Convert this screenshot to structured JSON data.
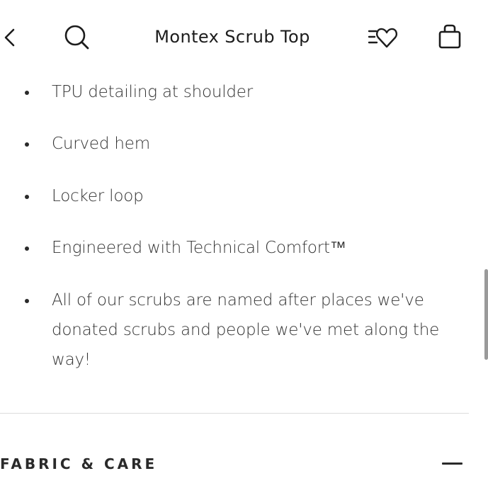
{
  "header": {
    "title": "Montex Scrub Top",
    "icons": {
      "back": "chevron-left-icon",
      "search": "search-icon",
      "wishlist": "heart-list-icon",
      "bag": "shopping-bag-icon"
    }
  },
  "features": [
    {
      "text": "TPU detailing at shoulder"
    },
    {
      "text": "Curved hem"
    },
    {
      "text": "Locker loop"
    },
    {
      "text": "Engineered with Technical Comfort™"
    },
    {
      "text": "All of our scrubs are named after places we've donated scrubs and people we've met along the way!"
    }
  ],
  "section": {
    "title": "FABRIC & CARE",
    "state_icon": "minus-icon",
    "expanded": true
  },
  "colors": {
    "text": "#2a2a2a",
    "divider": "#dcdcdc",
    "background": "#ffffff"
  }
}
